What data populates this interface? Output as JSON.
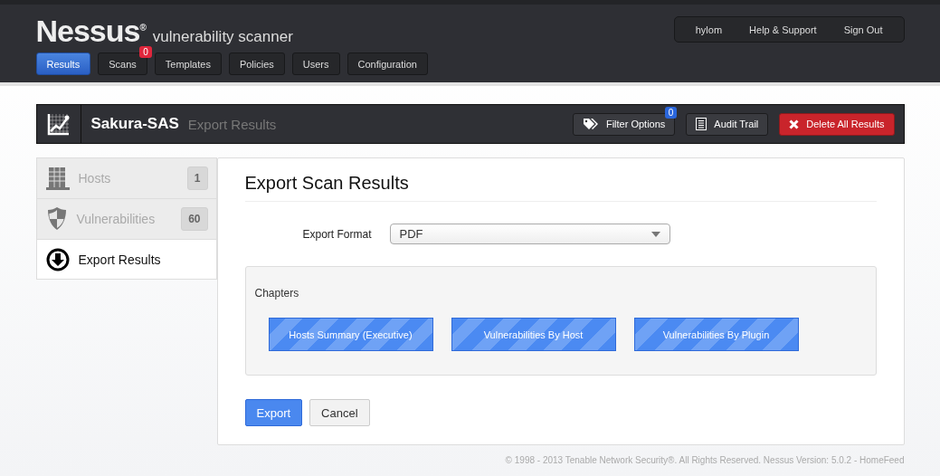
{
  "header": {
    "logo": "Nessus$^{®}$",
    "tagline": "vulnerability scanner",
    "nav": [
      {
        "label": "Results",
        "selected": true
      },
      {
        "label": "Scans",
        "selected": false,
        "badge": "0"
      },
      {
        "label": "Templates",
        "selected": false
      },
      {
        "label": "Policies",
        "selected": false
      },
      {
        "label": "Users",
        "selected": false
      },
      {
        "label": "Configuration",
        "selected": false
      }
    ],
    "user_menu": [
      "hylom",
      "Help & Support",
      "Sign Out"
    ]
  },
  "title_bar": {
    "title": "Sakura-SAS",
    "subtitle": "Export Results",
    "buttons": [
      {
        "kind": "filter",
        "label": "Filter Options",
        "badge": "0"
      },
      {
        "kind": "audit",
        "label": "Audit Trail"
      },
      {
        "kind": "delete",
        "label": "Delete All Results"
      }
    ]
  },
  "sidebar": {
    "items": [
      {
        "kind": "hosts",
        "label": "Hosts",
        "count": "1",
        "selected": false
      },
      {
        "kind": "vulns",
        "label": "Vulnerabilities",
        "count": "60",
        "selected": false
      },
      {
        "kind": "export",
        "label": "Export Results",
        "selected": true
      }
    ]
  },
  "panel": {
    "heading": "Export Scan Results",
    "format_label": "Export Format",
    "format_value": "PDF",
    "chapters_label": "Chapters",
    "chapters": [
      {
        "label": "Hosts Summary (Executive)",
        "selected": true
      },
      {
        "label": "Vulnerabilities By Host",
        "selected": true
      },
      {
        "label": "Vulnerabilities By Plugin",
        "selected": true
      }
    ],
    "buttons": [
      {
        "kind": "primary",
        "label": "Export"
      },
      {
        "kind": "default",
        "label": "Cancel"
      }
    ]
  },
  "footer": "© 1998 - 2013 Tenable Network Security®. All Rights Reserved. Nessus Version: 5.0.2 - HomeFeed"
}
